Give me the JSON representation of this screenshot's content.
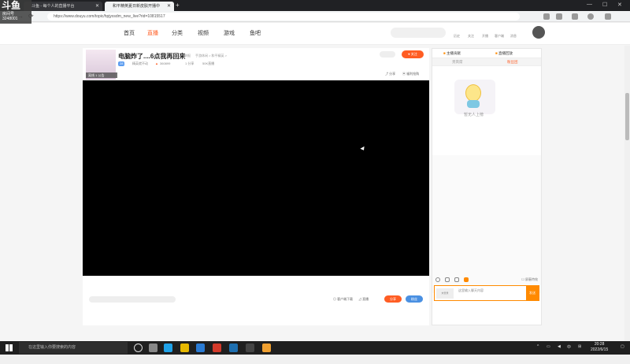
{
  "browser": {
    "tabs": [
      {
        "title": "斗鱼 - 每个人的直播平台",
        "active": false
      },
      {
        "title": "和平精英夏日新皮肤开播中",
        "active": true
      }
    ],
    "url": "https://www.douyu.com/topic/hpjyxsdm_new_live?rid=10815517"
  },
  "watermark": {
    "logo": "斗鱼",
    "room_label": "房间号",
    "room_no": "3248001"
  },
  "site_nav": {
    "items": [
      "首页",
      "直播",
      "分类",
      "视频",
      "游戏",
      "鱼吧"
    ],
    "active": "直播",
    "small_links": [
      "历史",
      "关注",
      "开播",
      "客户端",
      "消息"
    ]
  },
  "room": {
    "title": "电脑炸了....6点我再回来",
    "report": "举报",
    "meta": "手游休闲 > 和平精英 >",
    "tag": "28",
    "tag_text": "精英就不动",
    "heat": "360899",
    "shares": "1 分享",
    "hours": "50K直播",
    "follow_label": "关注",
    "avatar_bar": "离线   1 公告",
    "actions": [
      "分享",
      "福利抢购"
    ],
    "footer_links": [
      "客户端下载",
      "直播"
    ],
    "footer_buttons": [
      {
        "label": "分享",
        "color": "#ff5d23"
      },
      {
        "label": "粉丝",
        "color": "#4a90e2"
      }
    ]
  },
  "side": {
    "top_links": [
      "主播贡献",
      "直播回放"
    ],
    "tabs": [
      "贵宾席",
      "粉丝团"
    ],
    "active_tab": "粉丝团",
    "mascot_text": "暂无人上榜",
    "mask_toggle": "屏蔽特效",
    "chat_placeholder": "这里输入聊天内容",
    "chat_avatar": "未登录",
    "send_label": "发送"
  },
  "taskbar": {
    "search_placeholder": "在这里输入你要搜索的内容",
    "time": "20:28",
    "date": "2022/6/15",
    "lang": "中"
  },
  "colors": {
    "accent": "#ff5d23",
    "send": "#ff8a00",
    "blue": "#4a90e2"
  }
}
